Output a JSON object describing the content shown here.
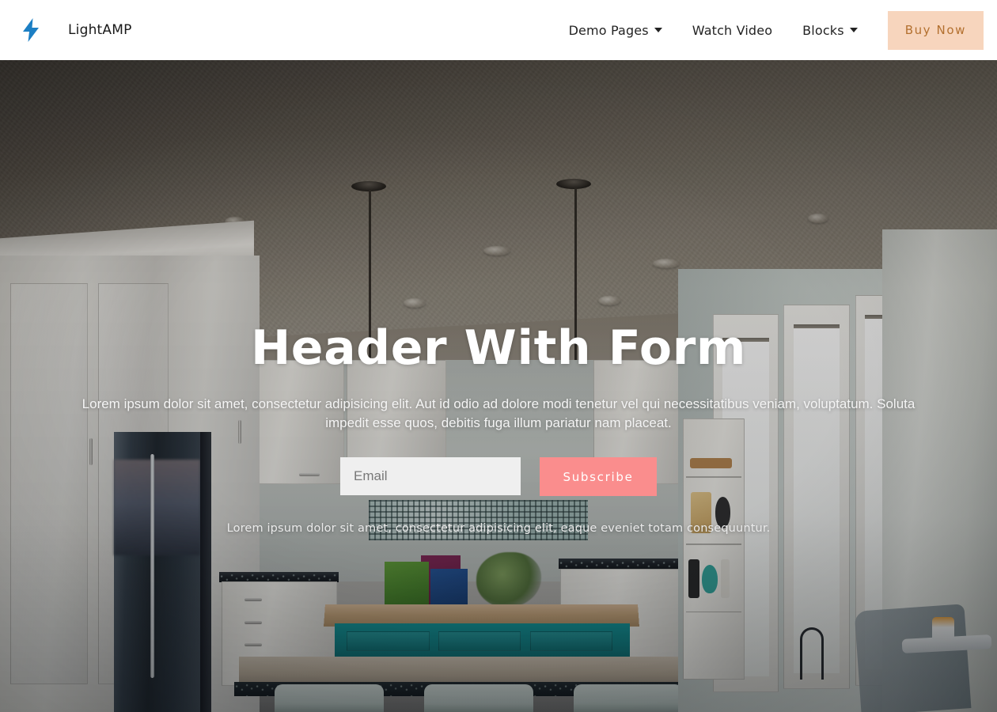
{
  "navbar": {
    "logo_icon": "lightning-bolt-icon",
    "brand": "LightAMP",
    "links": [
      {
        "label": "Demo Pages",
        "has_caret": true,
        "caret_icon": "chevron-down-icon"
      },
      {
        "label": "Watch Video",
        "has_caret": false
      },
      {
        "label": "Blocks",
        "has_caret": true,
        "caret_icon": "chevron-down-icon"
      }
    ],
    "cta": "Buy Now"
  },
  "hero": {
    "title": "Header With Form",
    "subtitle": "Lorem ipsum dolor sit amet, consectetur adipisicing elit. Aut id odio ad dolore modi tenetur vel qui necessitatibus veniam, voluptatum. Soluta impedit esse quos, debitis fuga illum pariatur nam placeat.",
    "form": {
      "email_placeholder": "Email",
      "email_value": "",
      "submit_label": "Subscribe"
    },
    "note": "Lorem ipsum dolor sit amet, consectetur adipisicing elit, eaque eveniet totam consequuntur.",
    "background_image": "kitchen-interior-photo"
  },
  "colors": {
    "logo_blue": "#1c7fc4",
    "cta_bg": "#f7d5bd",
    "cta_text": "#b3702f",
    "subscribe_bg": "#fa8d8d",
    "subscribe_text": "#ffffff",
    "input_bg": "#efefef",
    "navbar_bg": "#ffffff",
    "hero_text": "#ffffff"
  }
}
